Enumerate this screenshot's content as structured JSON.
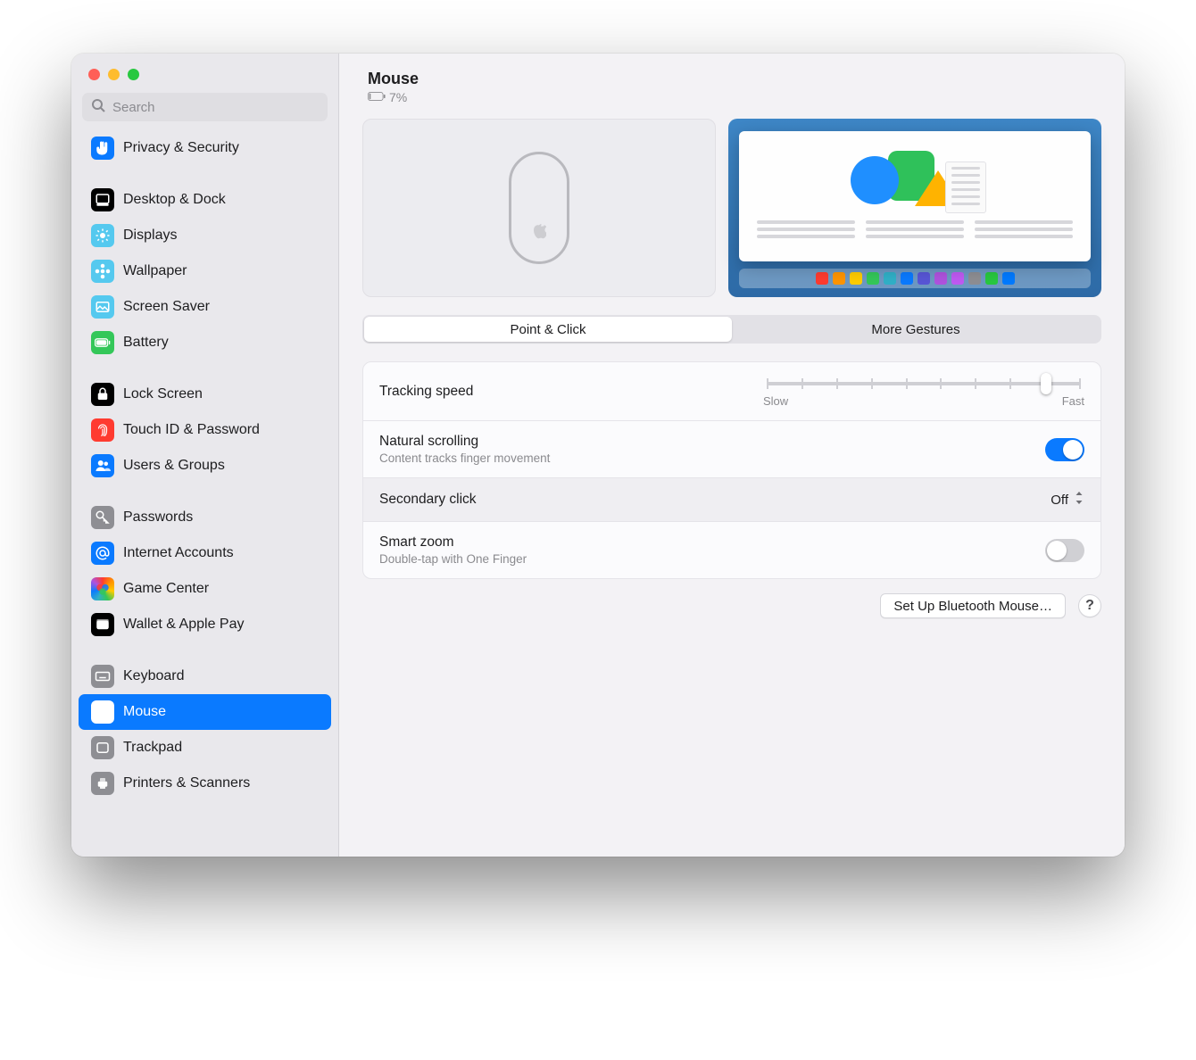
{
  "search": {
    "placeholder": "Search"
  },
  "traffic_lights": {
    "close": "#ff5f57",
    "min": "#febc2e",
    "zoom": "#28c840"
  },
  "header": {
    "title": "Mouse",
    "battery_percent": "7%"
  },
  "sidebar": {
    "groups": [
      [
        {
          "id": "privacy-security",
          "label": "Privacy & Security",
          "icon": "hand-icon",
          "color": "ic-blue"
        }
      ],
      [
        {
          "id": "desktop-dock",
          "label": "Desktop & Dock",
          "icon": "dock-icon",
          "color": "ic-black"
        },
        {
          "id": "displays",
          "label": "Displays",
          "icon": "sun-icon",
          "color": "ic-cyan"
        },
        {
          "id": "wallpaper",
          "label": "Wallpaper",
          "icon": "flower-icon",
          "color": "ic-cyan"
        },
        {
          "id": "screen-saver",
          "label": "Screen Saver",
          "icon": "photo-icon",
          "color": "ic-cyan"
        },
        {
          "id": "battery",
          "label": "Battery",
          "icon": "battery-icon",
          "color": "ic-green"
        }
      ],
      [
        {
          "id": "lock-screen",
          "label": "Lock Screen",
          "icon": "lock-icon",
          "color": "ic-black"
        },
        {
          "id": "touch-id",
          "label": "Touch ID & Password",
          "icon": "fingerprint-icon",
          "color": "ic-red"
        },
        {
          "id": "users-groups",
          "label": "Users & Groups",
          "icon": "users-icon",
          "color": "ic-blue"
        }
      ],
      [
        {
          "id": "passwords",
          "label": "Passwords",
          "icon": "key-icon",
          "color": "ic-grey"
        },
        {
          "id": "internet-accounts",
          "label": "Internet Accounts",
          "icon": "at-icon",
          "color": "ic-blue"
        },
        {
          "id": "game-center",
          "label": "Game Center",
          "icon": "gamecenter-icon",
          "color": "ic-gamecenter"
        },
        {
          "id": "wallet",
          "label": "Wallet & Apple Pay",
          "icon": "wallet-icon",
          "color": "ic-black"
        }
      ],
      [
        {
          "id": "keyboard",
          "label": "Keyboard",
          "icon": "keyboard-icon",
          "color": "ic-grey"
        },
        {
          "id": "mouse",
          "label": "Mouse",
          "icon": "mouse-icon",
          "color": "ic-sel",
          "selected": true
        },
        {
          "id": "trackpad",
          "label": "Trackpad",
          "icon": "trackpad-icon",
          "color": "ic-grey"
        },
        {
          "id": "printers",
          "label": "Printers & Scanners",
          "icon": "printer-icon",
          "color": "ic-grey"
        }
      ]
    ]
  },
  "tabs": {
    "point_click": "Point & Click",
    "more_gestures": "More Gestures",
    "active": "point_click"
  },
  "settings": {
    "tracking": {
      "title": "Tracking speed",
      "slow": "Slow",
      "fast": "Fast",
      "ticks": 10,
      "value_index": 8
    },
    "natural_scrolling": {
      "title": "Natural scrolling",
      "subtitle": "Content tracks finger movement",
      "on": true
    },
    "secondary_click": {
      "title": "Secondary click",
      "value": "Off"
    },
    "smart_zoom": {
      "title": "Smart zoom",
      "subtitle": "Double-tap with One Finger",
      "on": false
    }
  },
  "footer": {
    "setup_button": "Set Up Bluetooth Mouse…",
    "help": "?"
  },
  "dock_colors": [
    "#ff3b30",
    "#ff9500",
    "#ffcc00",
    "#34c759",
    "#30b0c7",
    "#0a7aff",
    "#5856d6",
    "#af52de",
    "#bf5af2",
    "#8e8e93",
    "#28c840",
    "#007aff"
  ]
}
